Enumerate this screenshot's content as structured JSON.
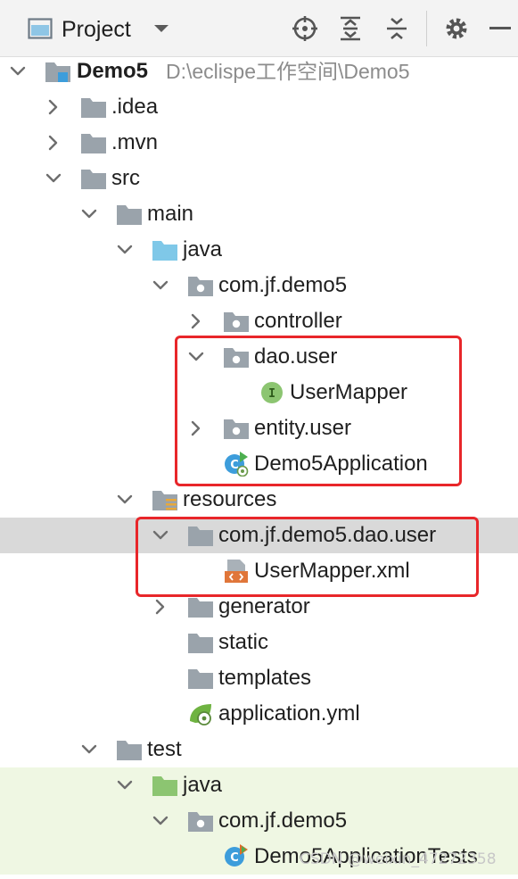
{
  "toolbar": {
    "view_title": "Project",
    "icons": [
      "project-view-icon",
      "dropdown-icon",
      "locate-icon",
      "expand-all-icon",
      "collapse-all-icon",
      "settings-icon",
      "hide-icon"
    ]
  },
  "tree": {
    "root": {
      "label": "Demo5",
      "path": "D:\\eclispe工作空间\\Demo5"
    },
    "idea": "idea_label_placeholder",
    "items": {
      "idea": ".idea",
      "mvn": ".mvn",
      "src": "src",
      "main": "main",
      "java": "java",
      "pkg": "com.jf.demo5",
      "controller": "controller",
      "dao_user": "dao.user",
      "user_mapper": "UserMapper",
      "entity_user": "entity.user",
      "app": "Demo5Application",
      "resources": "resources",
      "res_pkg": "com.jf.demo5.dao.user",
      "user_mapper_xml": "UserMapper.xml",
      "generator": "generator",
      "static": "static",
      "templates": "templates",
      "application_yml": "application.yml",
      "test": "test",
      "test_java": "java",
      "test_pkg": "com.jf.demo5",
      "app_tests": "Demo5ApplicationTests"
    }
  },
  "colors": {
    "highlight": "#e8262a",
    "selected_row": "#d9d9d9",
    "test_row": "#eff7e3",
    "folder_gray": "#9aa3ab",
    "folder_source": "#7fc8e8",
    "folder_test": "#8cc571"
  },
  "watermark": "CSDN @weixin_47272358"
}
